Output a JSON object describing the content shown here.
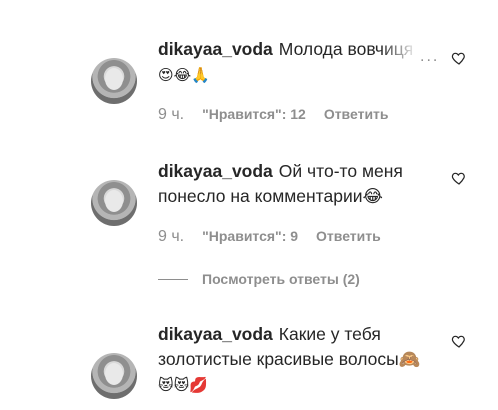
{
  "comments": [
    {
      "username": "dikayaa_voda",
      "text": "Молода вовчиця",
      "emoji": "😍😂🙏",
      "time": "9 ч.",
      "likes": "\"Нравится\": 12",
      "reply": "Ответить",
      "more": "..."
    },
    {
      "username": "dikayaa_voda",
      "text": "Ой что-то меня понесло на комментарии😂",
      "time": "9 ч.",
      "likes": "\"Нравится\": 9",
      "reply": "Ответить"
    },
    {
      "username": "dikayaa_voda",
      "text": "Какие у тебя золотистые красивые волосы🙈",
      "emoji": "😻😻💋"
    }
  ],
  "view_replies": "Посмотреть ответы (2)"
}
